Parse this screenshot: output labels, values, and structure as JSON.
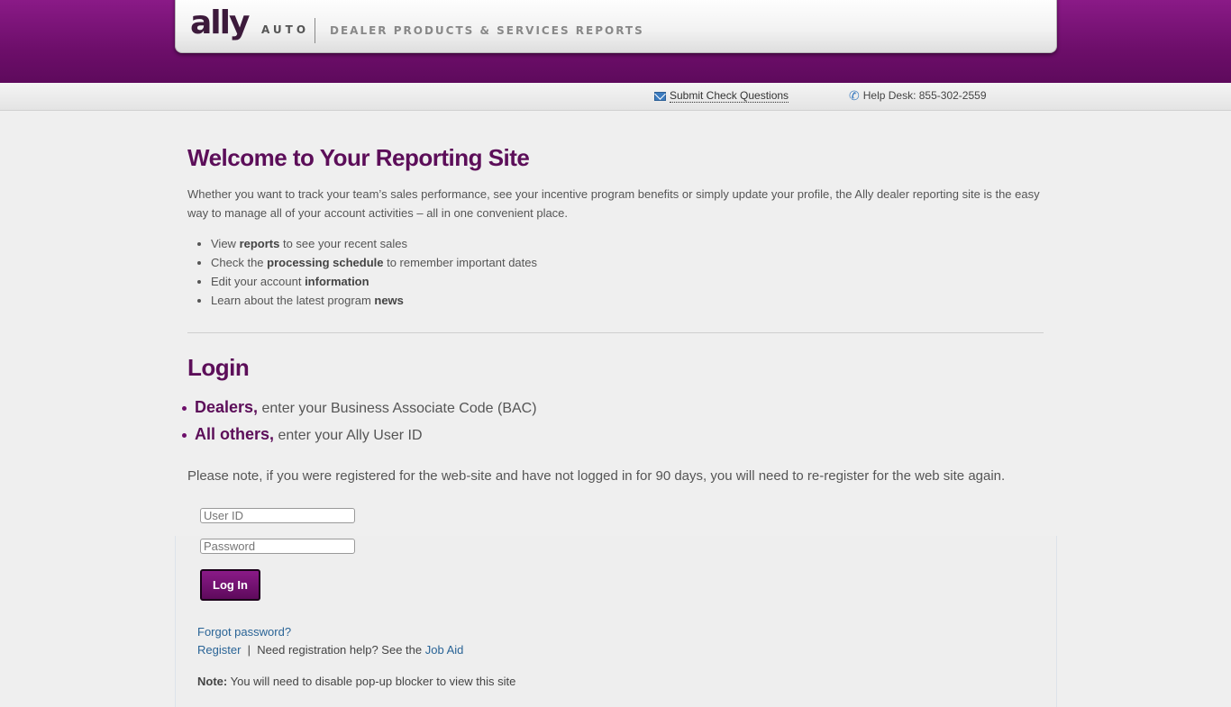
{
  "header": {
    "logo": "ally",
    "logo_sub": "AUTO",
    "title": "DEALER PRODUCTS & SERVICES REPORTS"
  },
  "utility": {
    "submit_check": "Submit Check Questions",
    "help_desk": "Help Desk: 855-302-2559"
  },
  "welcome": {
    "title": "Welcome to Your Reporting Site",
    "intro": "Whether you want to track your team’s sales performance, see your incentive program benefits or simply update your profile, the Ally dealer reporting site is the easy way to manage all of your account activities – all in one convenient place.",
    "features": [
      {
        "pre": "View ",
        "bold": "reports",
        "post": " to see your recent sales"
      },
      {
        "pre": "Check the ",
        "bold": "processing schedule",
        "post": " to remember important dates"
      },
      {
        "pre": "Edit your account ",
        "bold": "information",
        "post": ""
      },
      {
        "pre": "Learn about the latest program ",
        "bold": "news",
        "post": ""
      }
    ]
  },
  "login": {
    "title": "Login",
    "who": [
      {
        "bold": "Dealers,",
        "text": " enter your Business Associate Code (BAC)"
      },
      {
        "bold": "All others,",
        "text": " enter your Ally User ID"
      }
    ],
    "note90": "Please note, if you were registered for the web-site and have not logged in for 90 days, you will need to re-register for the web site again.",
    "user_placeholder": "User ID",
    "pass_placeholder": "Password",
    "button": "Log In",
    "forgot": "Forgot password?",
    "register": "Register",
    "sep": "|",
    "help_text": "Need registration help? See the",
    "job_aid": "Job Aid",
    "note_label": "Note:",
    "note_text": "You will need to disable pop-up blocker to view this site"
  }
}
